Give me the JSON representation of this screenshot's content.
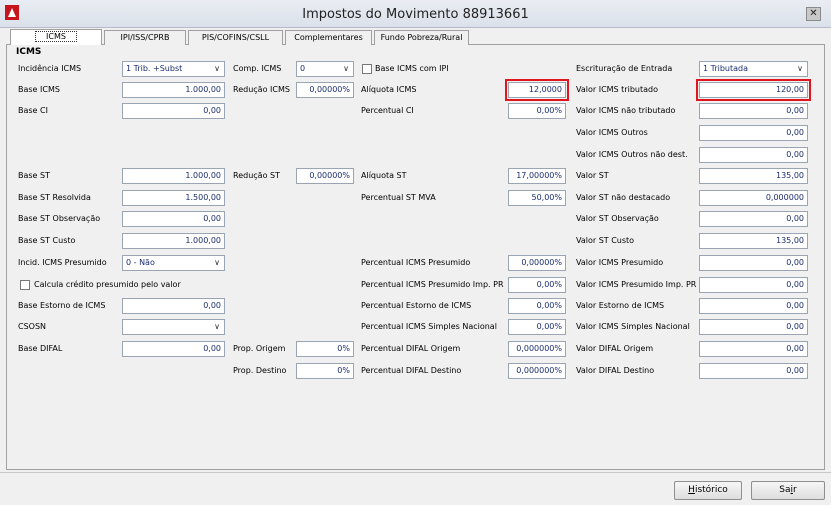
{
  "window": {
    "title": "Impostos do Movimento 88913661",
    "close_glyph": "✕"
  },
  "tabs": [
    "ICMS",
    "IPI/ISS/CPRB",
    "PIS/COFINS/CSLL",
    "Complementares",
    "Fundo Pobreza/Rural"
  ],
  "section_title": "ICMS",
  "col1": {
    "incidencia_icms": {
      "label": "Incidência ICMS",
      "value": "1 Trib. +Subst"
    },
    "base_icms": {
      "label": "Base ICMS",
      "value": "1.000,00"
    },
    "base_ci": {
      "label": "Base CI",
      "value": "0,00"
    },
    "base_st": {
      "label": "Base ST",
      "value": "1.000,00"
    },
    "base_st_resolvida": {
      "label": "Base ST Resolvida",
      "value": "1.500,00"
    },
    "base_st_observacao": {
      "label": "Base ST Observação",
      "value": "0,00"
    },
    "base_st_custo": {
      "label": "Base ST Custo",
      "value": "1.000,00"
    },
    "incid_icms_presumido": {
      "label": "Incid. ICMS Presumido",
      "value": "0 - Não"
    },
    "calcula_credito": {
      "label": "Calcula crédito presumido pelo valor"
    },
    "base_estorno_icms": {
      "label": "Base Estorno de ICMS",
      "value": "0,00"
    },
    "csosn": {
      "label": "CSOSN",
      "value": ""
    },
    "base_difal": {
      "label": "Base DIFAL",
      "value": "0,00"
    }
  },
  "col2": {
    "comp_icms": {
      "label": "Comp. ICMS",
      "value": "0"
    },
    "reducao_icms": {
      "label": "Redução ICMS",
      "value": "0,00000%"
    },
    "reducao_st": {
      "label": "Redução ST",
      "value": "0,00000%"
    },
    "prop_origem": {
      "label": "Prop. Origem",
      "value": "0%"
    },
    "prop_destino": {
      "label": "Prop. Destino",
      "value": "0%"
    }
  },
  "col3": {
    "base_icms_com_ipi": {
      "label": "Base ICMS com IPI"
    },
    "aliquota_icms": {
      "label": "Alíquota ICMS",
      "value": "12,0000"
    },
    "percentual_ci": {
      "label": "Percentual CI",
      "value": "0,00%"
    },
    "aliquota_st": {
      "label": "Alíquota ST",
      "value": "17,00000%"
    },
    "percentual_st_mva": {
      "label": "Percentual ST MVA",
      "value": "50,00%"
    },
    "percentual_icms_presumido": {
      "label": "Percentual ICMS Presumido",
      "value": "0,00000%"
    },
    "percentual_icms_presumido_pr": {
      "label": "Percentual ICMS Presumido Imp. PR",
      "value": "0,00%"
    },
    "percentual_estorno_icms": {
      "label": "Percentual Estorno de ICMS",
      "value": "0,00%"
    },
    "percentual_icms_simples": {
      "label": "Percentual ICMS Simples Nacional",
      "value": "0,00%"
    },
    "percentual_difal_origem": {
      "label": "Percentual DIFAL Origem",
      "value": "0,000000%"
    },
    "percentual_difal_destino": {
      "label": "Percentual DIFAL Destino",
      "value": "0,000000%"
    }
  },
  "col4": {
    "escrituracao_entrada": {
      "label": "Escrituração de Entrada",
      "value": "1 Tributada"
    },
    "valor_icms_tributado": {
      "label": "Valor ICMS tributado",
      "value": "120,00"
    },
    "valor_icms_nao_tributado": {
      "label": "Valor ICMS não tributado",
      "value": "0,00"
    },
    "valor_icms_outros": {
      "label": "Valor ICMS Outros",
      "value": "0,00"
    },
    "valor_icms_outros_nao_dest": {
      "label": "Valor ICMS Outros não dest.",
      "value": "0,00"
    },
    "valor_st": {
      "label": "Valor ST",
      "value": "135,00"
    },
    "valor_st_nao_destacado": {
      "label": "Valor ST não destacado",
      "value": "0,000000"
    },
    "valor_st_observacao": {
      "label": "Valor ST Observação",
      "value": "0,00"
    },
    "valor_st_custo": {
      "label": "Valor ST Custo",
      "value": "135,00"
    },
    "valor_icms_presumido": {
      "label": "Valor ICMS Presumido",
      "value": "0,00"
    },
    "valor_icms_presumido_pr": {
      "label": "Valor ICMS Presumido Imp. PR",
      "value": "0,00"
    },
    "valor_estorno_icms": {
      "label": "Valor Estorno de ICMS",
      "value": "0,00"
    },
    "valor_icms_simples": {
      "label": "Valor ICMS Simples Nacional",
      "value": "0,00"
    },
    "valor_difal_origem": {
      "label": "Valor DIFAL Origem",
      "value": "0,00"
    },
    "valor_difal_destino": {
      "label": "Valor DIFAL Destino",
      "value": "0,00"
    }
  },
  "buttons": {
    "historico": {
      "accel": "H",
      "rest": "istórico"
    },
    "sair": {
      "pre": "Sa",
      "accel": "i",
      "rest": "r"
    }
  }
}
